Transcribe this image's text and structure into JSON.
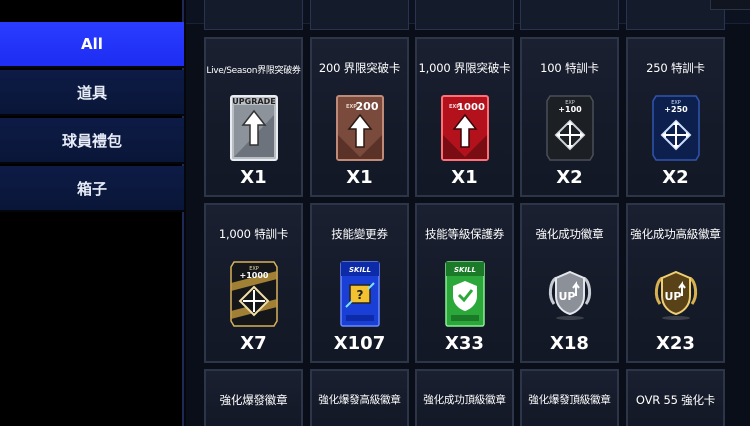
{
  "sidebar": {
    "tabs": [
      {
        "label": "All",
        "active": true
      },
      {
        "label": "道具",
        "active": false
      },
      {
        "label": "球員禮包",
        "active": false
      },
      {
        "label": "箱子",
        "active": false
      }
    ]
  },
  "colors": {
    "active_tab": "#1f30f5",
    "inactive_tab": "#0c1940",
    "card_bg": "#171d2c",
    "card_border": "#2c3648"
  },
  "items": [
    {
      "name": "Live/Season界限突破券",
      "quantity": "X1",
      "icon": "upgrade-card-icon",
      "card_text": "UPGRADE"
    },
    {
      "name": "200 界限突破卡",
      "quantity": "X1",
      "icon": "exp-200-card-icon",
      "card_text": "200",
      "exp_label": "EXP"
    },
    {
      "name": "1,000 界限突破卡",
      "quantity": "X1",
      "icon": "exp-1000-card-icon",
      "card_text": "1000",
      "exp_label": "EXP"
    },
    {
      "name": "100 特訓卡",
      "quantity": "X2",
      "icon": "training-100-card-icon",
      "card_text": "+100",
      "exp_label": "EXP"
    },
    {
      "name": "250 特訓卡",
      "quantity": "X2",
      "icon": "training-250-card-icon",
      "card_text": "+250",
      "exp_label": "EXP"
    },
    {
      "name": "1,000 特訓卡",
      "quantity": "X7",
      "icon": "training-1000-card-icon",
      "card_text": "+1000",
      "exp_label": "EXP"
    },
    {
      "name": "技能變更券",
      "quantity": "X107",
      "icon": "skill-change-ticket-icon",
      "card_text": "SKILL"
    },
    {
      "name": "技能等級保護券",
      "quantity": "X33",
      "icon": "skill-protect-ticket-icon",
      "card_text": "SKILL"
    },
    {
      "name": "強化成功徽章",
      "quantity": "X18",
      "icon": "upgrade-success-badge-icon",
      "card_text": "UP"
    },
    {
      "name": "強化成功高級徽章",
      "quantity": "X23",
      "icon": "upgrade-success-advanced-badge-icon",
      "card_text": "UP"
    },
    {
      "name": "強化爆發徽章",
      "quantity": "",
      "icon": "",
      "card_text": ""
    },
    {
      "name": "強化爆發高級徽章",
      "quantity": "",
      "icon": "",
      "card_text": ""
    },
    {
      "name": "強化成功頂級徽章",
      "quantity": "",
      "icon": "",
      "card_text": ""
    },
    {
      "name": "強化爆發頂級徽章",
      "quantity": "",
      "icon": "",
      "card_text": ""
    },
    {
      "name": "OVR 55 強化卡",
      "quantity": "",
      "icon": "",
      "card_text": ""
    }
  ]
}
